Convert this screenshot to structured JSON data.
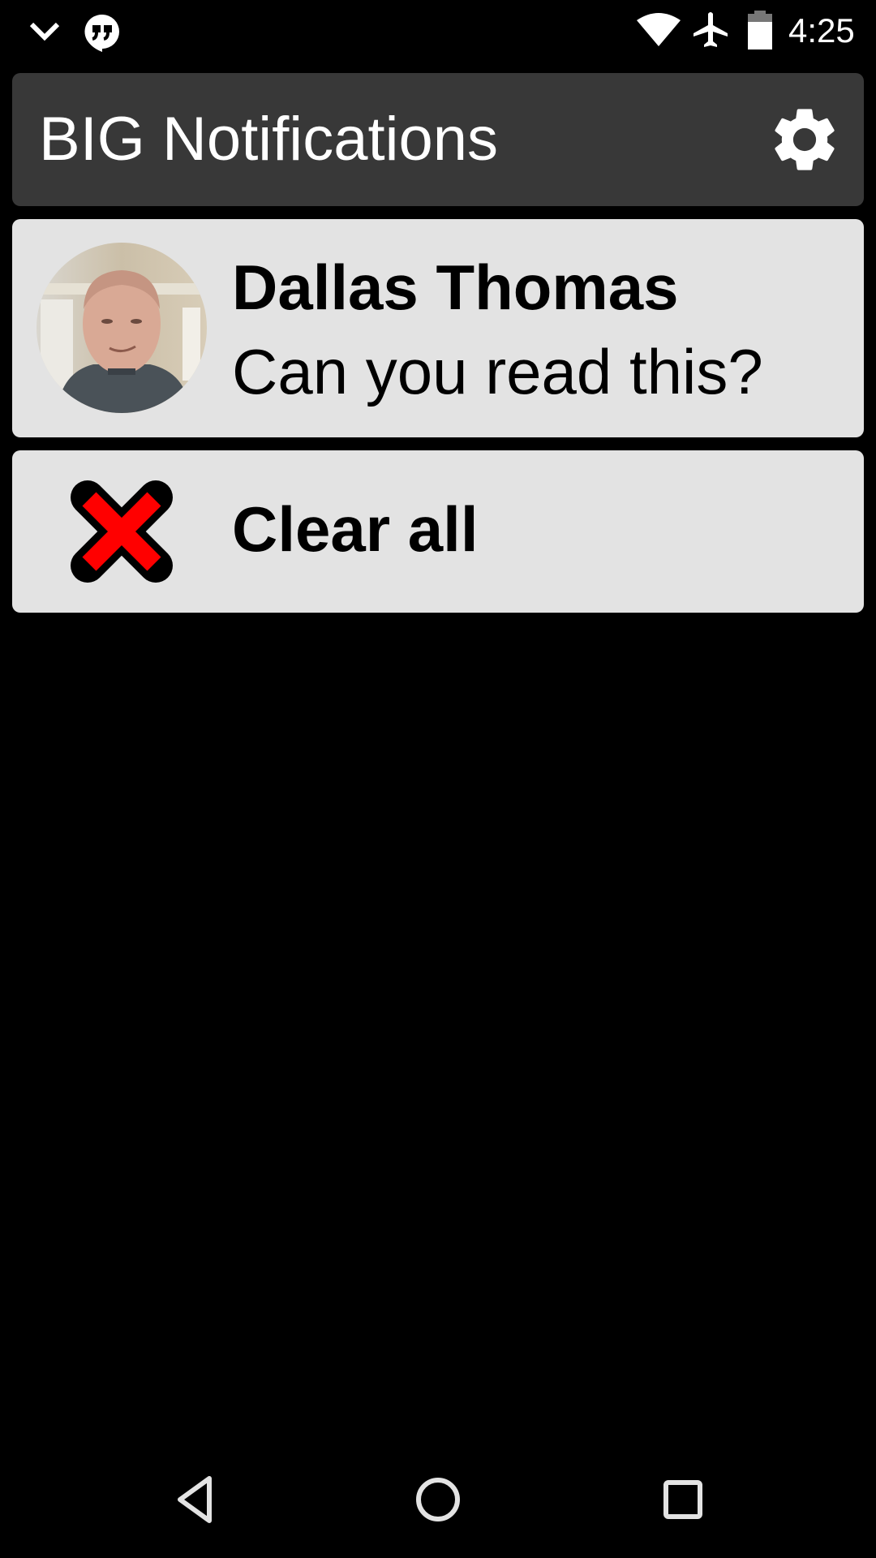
{
  "status_bar": {
    "time": "4:25",
    "left_icons": [
      "chevron-down-icon",
      "hangouts-icon"
    ],
    "right_icons": [
      "wifi-icon",
      "airplane-mode-icon",
      "battery-icon"
    ]
  },
  "header": {
    "title": "BIG Notifications",
    "settings_icon": "gear-icon"
  },
  "notifications": [
    {
      "sender": "Dallas Thomas",
      "message": "Can you read this?",
      "avatar": "contact-photo"
    }
  ],
  "clear_all": {
    "label": "Clear all",
    "icon": "red-x-icon",
    "icon_color": "#ff0000"
  },
  "nav_bar": {
    "buttons": [
      "back",
      "home",
      "recents"
    ]
  },
  "colors": {
    "background": "#000000",
    "header_bg": "#383838",
    "card_bg": "#e3e3e3"
  }
}
